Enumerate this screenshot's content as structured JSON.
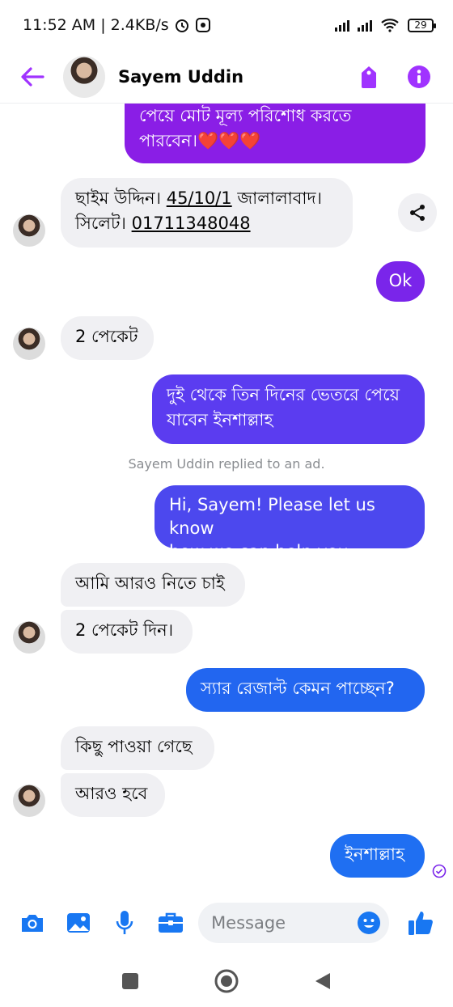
{
  "status_bar": {
    "time": "11:52 AM | 2.4KB/s",
    "battery": "29"
  },
  "header": {
    "contact_name": "Sayem Uddin"
  },
  "messages": {
    "m1_line1": "পেয়ে মোট মূল্য পরিশোধ করতে",
    "m1_line2": "পারবেন।",
    "m1_emoji": "❤️❤️❤️",
    "m2_a": "ছাইম উদ্দিন। ",
    "m2_b": "45/10/1",
    "m2_c": " জালালাবাদ।",
    "m2_d": "সিলেট। ",
    "m2_e": "01711348048",
    "m3": "Ok",
    "m4": "2 পেকেট",
    "m5_line1": "দুই থেকে তিন দিনের ভেতরে পেয়ে",
    "m5_line2": "যাবেন ইনশাল্লাহ",
    "system_note": "Sayem Uddin replied to an ad.",
    "m6_line1": "Hi, Sayem! Please let us know",
    "m6_line2": "how we can help you.",
    "m7": "আমি আরও নিতে চাই",
    "m8": "2 পেকেট দিন।",
    "m9": "স্যার রেজাল্ট কেমন পাচ্ছেন?",
    "m10": "কিছু পাওয়া গেছে",
    "m11": "আরও হবে",
    "m12": "ইনশাল্লাহ"
  },
  "composer": {
    "placeholder": "Message"
  },
  "colors": {
    "accent": "#a033ff",
    "purple_bubble": "#8a1ee6",
    "indigo_bubble": "#5b3cf0",
    "blue_bubble": "#1f6ff2",
    "incoming_bubble": "#f0f0f3"
  },
  "icons": [
    "back-arrow-icon",
    "tag-icon",
    "info-icon",
    "share-icon",
    "camera-icon",
    "image-icon",
    "microphone-icon",
    "briefcase-icon",
    "emoji-icon",
    "thumbs-up-icon",
    "seen-check-icon",
    "nav-square-icon",
    "nav-home-icon",
    "nav-back-icon"
  ]
}
